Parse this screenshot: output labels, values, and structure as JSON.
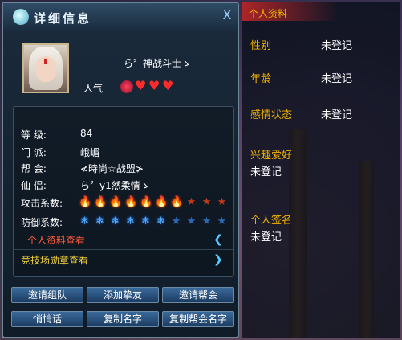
{
  "window": {
    "title": "详细信息",
    "close_label": "X"
  },
  "profile": {
    "name": "ら〞神战斗士ゝ",
    "popularity_label": "人气"
  },
  "info": {
    "level_key": "等    级:",
    "level_val": "84",
    "sect_key": "门    派:",
    "sect_val": "峨嵋",
    "guild_key": "帮    会:",
    "guild_val": "≮時尚☆战盟≯",
    "partner_key": "仙    侣:",
    "partner_val": "ら〞y1然柔情ゝ",
    "attack_key": "攻击系数:",
    "attack_level": 7,
    "attack_max": 10,
    "defense_key": "防御系数:",
    "defense_level": 6,
    "defense_max": 10
  },
  "links": {
    "personal_info": "个人资料查看",
    "arena_medals": "竞技场勋章查看"
  },
  "buttons": {
    "invite_team": "邀请组队",
    "add_friend": "添加挚友",
    "invite_guild": "邀请帮会",
    "whisper": "悄悄话",
    "copy_name": "复制名字",
    "copy_guild_name": "复制帮会名字"
  },
  "personal": {
    "header": "个人资料",
    "gender_label": "性别",
    "gender_val": "未登记",
    "age_label": "年龄",
    "age_val": "未登记",
    "relationship_label": "感情状态",
    "relationship_val": "未登记",
    "hobby_label": "兴趣爱好",
    "hobby_val": "未登记",
    "signature_label": "个人签名",
    "signature_val": "未登记"
  },
  "colors": {
    "accent": "#f0b400",
    "link_red": "#ff5a3a",
    "link_yellow": "#f0d040"
  }
}
